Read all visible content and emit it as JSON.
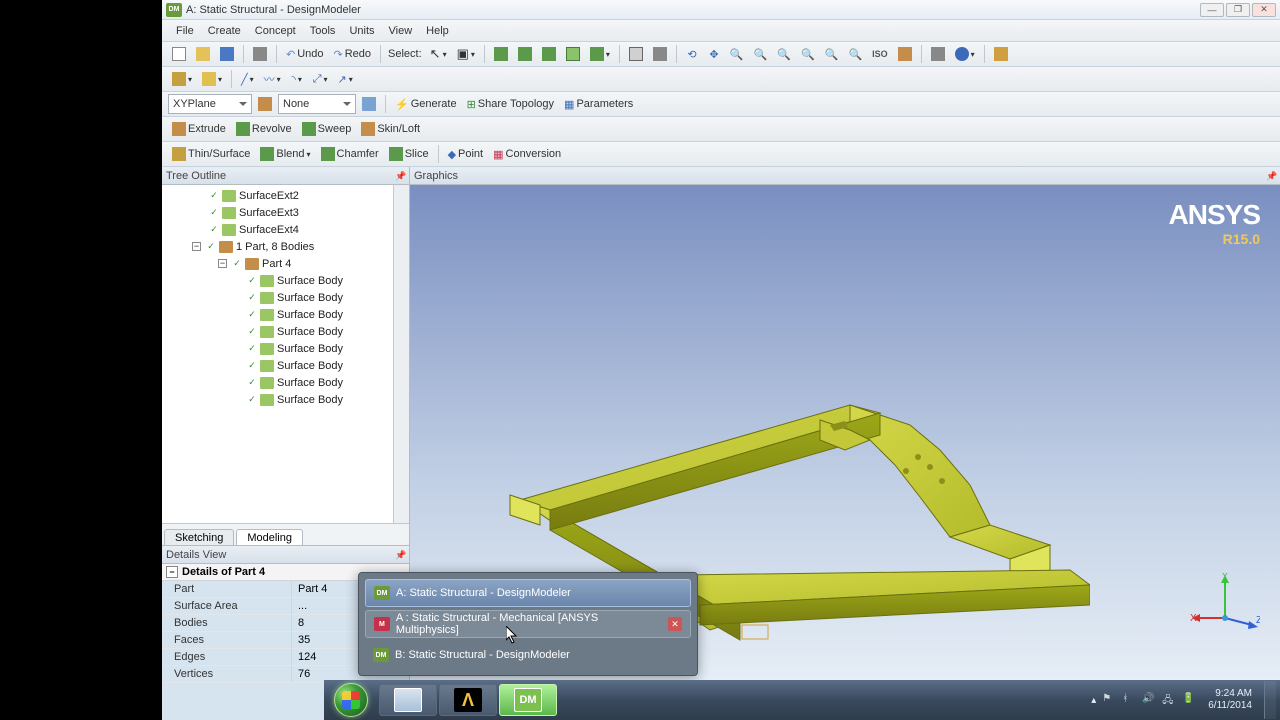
{
  "title": "A: Static Structural - DesignModeler",
  "menus": [
    "File",
    "Create",
    "Concept",
    "Tools",
    "Units",
    "View",
    "Help"
  ],
  "toolbar1": {
    "undo": "Undo",
    "redo": "Redo",
    "select_label": "Select:"
  },
  "toolbar3": {
    "plane": "XYPlane",
    "sketch": "None",
    "generate": "Generate",
    "share": "Share Topology",
    "params": "Parameters"
  },
  "toolbar4": {
    "extrude": "Extrude",
    "revolve": "Revolve",
    "sweep": "Sweep",
    "skin": "Skin/Loft"
  },
  "toolbar5": {
    "thin": "Thin/Surface",
    "blend": "Blend",
    "chamfer": "Chamfer",
    "slice": "Slice",
    "point": "Point",
    "conversion": "Conversion"
  },
  "panels": {
    "tree": "Tree Outline",
    "details": "Details View",
    "graphics": "Graphics"
  },
  "tabs": {
    "sketching": "Sketching",
    "modeling": "Modeling"
  },
  "tree": {
    "items": [
      {
        "indent": 44,
        "label": "SurfaceExt2",
        "ico": "body"
      },
      {
        "indent": 44,
        "label": "SurfaceExt3",
        "ico": "body"
      },
      {
        "indent": 44,
        "label": "SurfaceExt4",
        "ico": "body"
      },
      {
        "indent": 30,
        "label": "1 Part, 8 Bodies",
        "ico": "part",
        "exp": "−"
      },
      {
        "indent": 56,
        "label": "Part 4",
        "ico": "part",
        "exp": "−"
      },
      {
        "indent": 82,
        "label": "Surface Body",
        "ico": "body"
      },
      {
        "indent": 82,
        "label": "Surface Body",
        "ico": "body"
      },
      {
        "indent": 82,
        "label": "Surface Body",
        "ico": "body"
      },
      {
        "indent": 82,
        "label": "Surface Body",
        "ico": "body"
      },
      {
        "indent": 82,
        "label": "Surface Body",
        "ico": "body"
      },
      {
        "indent": 82,
        "label": "Surface Body",
        "ico": "body"
      },
      {
        "indent": 82,
        "label": "Surface Body",
        "ico": "body"
      },
      {
        "indent": 82,
        "label": "Surface Body",
        "ico": "body"
      }
    ]
  },
  "details": {
    "header": "Details of Part 4",
    "rows": [
      {
        "k": "Part",
        "v": "Part 4"
      },
      {
        "k": "Surface Area",
        "v": "..."
      },
      {
        "k": "Bodies",
        "v": "8"
      },
      {
        "k": "Faces",
        "v": "35"
      },
      {
        "k": "Edges",
        "v": "124"
      },
      {
        "k": "Vertices",
        "v": "76"
      }
    ]
  },
  "logo": {
    "name": "ANSYS",
    "ver": "R15.0"
  },
  "triad": {
    "x": "X",
    "y": "Y",
    "z": "Z"
  },
  "thumbs": {
    "items": [
      {
        "label": "A: Static Structural - DesignModeler",
        "ico": "dm",
        "state": "sel"
      },
      {
        "label": "A : Static Structural - Mechanical [ANSYS Multiphysics]",
        "ico": "mech",
        "state": "hover",
        "close": true
      },
      {
        "label": "B: Static Structural - DesignModeler",
        "ico": "dm",
        "state": ""
      }
    ]
  },
  "clock": {
    "time": "9:24 AM",
    "date": "6/11/2014"
  }
}
